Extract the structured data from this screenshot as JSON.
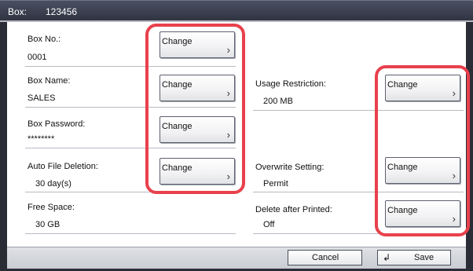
{
  "header": {
    "label": "Box:",
    "box_number": "123456"
  },
  "fields": {
    "box_no": {
      "label": "Box No.:",
      "value": "0001"
    },
    "box_name": {
      "label": "Box Name:",
      "value": "SALES"
    },
    "box_password": {
      "label": "Box Password:",
      "value": "********"
    },
    "auto_file_deletion": {
      "label": "Auto File Deletion:",
      "value": "30  day(s)"
    },
    "free_space": {
      "label": "Free Space:",
      "value": "30  GB"
    },
    "usage_restriction": {
      "label": "Usage Restriction:",
      "value": "200  MB"
    },
    "overwrite_setting": {
      "label": "Overwrite Setting:",
      "value": "Permit"
    },
    "delete_after_printed": {
      "label": "Delete after Printed:",
      "value": "Off"
    }
  },
  "buttons": {
    "change_label": "Change",
    "chevron": "›",
    "cancel_label": "Cancel",
    "save_label": "Save",
    "enter_icon": "↲"
  },
  "colors": {
    "highlight": "#e8414c",
    "title_bar": "#2f3340"
  }
}
